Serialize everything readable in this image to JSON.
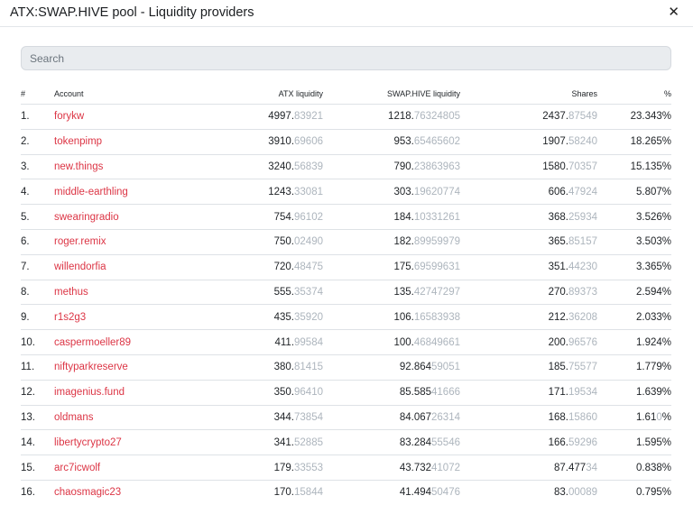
{
  "window": {
    "title": "ATX:SWAP.HIVE pool - Liquidity providers",
    "close_label": "✕"
  },
  "search": {
    "placeholder": "Search",
    "value": ""
  },
  "table": {
    "headers": [
      "#",
      "Account",
      "ATX liquidity",
      "SWAP.HIVE liquidity",
      "Shares",
      "%"
    ],
    "rows": [
      {
        "rank": "1.",
        "account": "forykw",
        "atx_int": "4997.",
        "atx_frac": "83921",
        "hive_int": "1218.",
        "hive_frac": "76324805",
        "shares_int": "2437.",
        "shares_frac": "87549",
        "pct": "23.343%"
      },
      {
        "rank": "2.",
        "account": "tokenpimp",
        "atx_int": "3910.",
        "atx_frac": "69606",
        "hive_int": "953.",
        "hive_frac": "65465602",
        "shares_int": "1907.",
        "shares_frac": "58240",
        "pct": "18.265%"
      },
      {
        "rank": "3.",
        "account": "new.things",
        "atx_int": "3240.",
        "atx_frac": "56839",
        "hive_int": "790.",
        "hive_frac": "23863963",
        "shares_int": "1580.",
        "shares_frac": "70357",
        "pct": "15.135%"
      },
      {
        "rank": "4.",
        "account": "middle-earthling",
        "atx_int": "1243.",
        "atx_frac": "33081",
        "hive_int": "303.",
        "hive_frac": "19620774",
        "shares_int": "606.",
        "shares_frac": "47924",
        "pct": "5.807%"
      },
      {
        "rank": "5.",
        "account": "swearingradio",
        "atx_int": "754.",
        "atx_frac": "96102",
        "hive_int": "184.",
        "hive_frac": "10331261",
        "shares_int": "368.",
        "shares_frac": "25934",
        "pct": "3.526%"
      },
      {
        "rank": "6.",
        "account": "roger.remix",
        "atx_int": "750.",
        "atx_frac": "02490",
        "hive_int": "182.",
        "hive_frac": "89959979",
        "shares_int": "365.",
        "shares_frac": "85157",
        "pct": "3.503%"
      },
      {
        "rank": "7.",
        "account": "willendorfia",
        "atx_int": "720.",
        "atx_frac": "48475",
        "hive_int": "175.",
        "hive_frac": "69599631",
        "shares_int": "351.",
        "shares_frac": "44230",
        "pct": "3.365%"
      },
      {
        "rank": "8.",
        "account": "methus",
        "atx_int": "555.",
        "atx_frac": "35374",
        "hive_int": "135.",
        "hive_frac": "42747297",
        "shares_int": "270.",
        "shares_frac": "89373",
        "pct": "2.594%"
      },
      {
        "rank": "9.",
        "account": "r1s2g3",
        "atx_int": "435.",
        "atx_frac": "35920",
        "hive_int": "106.",
        "hive_frac": "16583938",
        "shares_int": "212.",
        "shares_frac": "36208",
        "pct": "2.033%"
      },
      {
        "rank": "10.",
        "account": "caspermoeller89",
        "atx_int": "411.",
        "atx_frac": "99584",
        "hive_int": "100.",
        "hive_frac": "46849661",
        "shares_int": "200.",
        "shares_frac": "96576",
        "pct": "1.924%"
      },
      {
        "rank": "11.",
        "account": "niftyparkreserve",
        "atx_int": "380.",
        "atx_frac": "81415",
        "hive_int": "92.864",
        "hive_frac": "59051",
        "shares_int": "185.",
        "shares_frac": "75577",
        "pct": "1.779%"
      },
      {
        "rank": "12.",
        "account": "imagenius.fund",
        "atx_int": "350.",
        "atx_frac": "96410",
        "hive_int": "85.585",
        "hive_frac": "41666",
        "shares_int": "171.",
        "shares_frac": "19534",
        "pct": "1.639%"
      },
      {
        "rank": "13.",
        "account": "oldmans",
        "atx_int": "344.",
        "atx_frac": "73854",
        "hive_int": "84.067",
        "hive_frac": "26314",
        "shares_int": "168.",
        "shares_frac": "15860",
        "pct_int": "1.61",
        "pct_dim": "0",
        "pct_tail": "%"
      },
      {
        "rank": "14.",
        "account": "libertycrypto27",
        "atx_int": "341.",
        "atx_frac": "52885",
        "hive_int": "83.284",
        "hive_frac": "55546",
        "shares_int": "166.",
        "shares_frac": "59296",
        "pct": "1.595%"
      },
      {
        "rank": "15.",
        "account": "arc7icwolf",
        "atx_int": "179.",
        "atx_frac": "33553",
        "hive_int": "43.732",
        "hive_frac": "41072",
        "shares_int": "87.477",
        "shares_frac": "34",
        "pct": "0.838%"
      },
      {
        "rank": "16.",
        "account": "chaosmagic23",
        "atx_int": "170.",
        "atx_frac": "15844",
        "hive_int": "41.494",
        "hive_frac": "50476",
        "shares_int": "83.",
        "shares_frac": "00089",
        "pct": "0.795%"
      }
    ]
  }
}
